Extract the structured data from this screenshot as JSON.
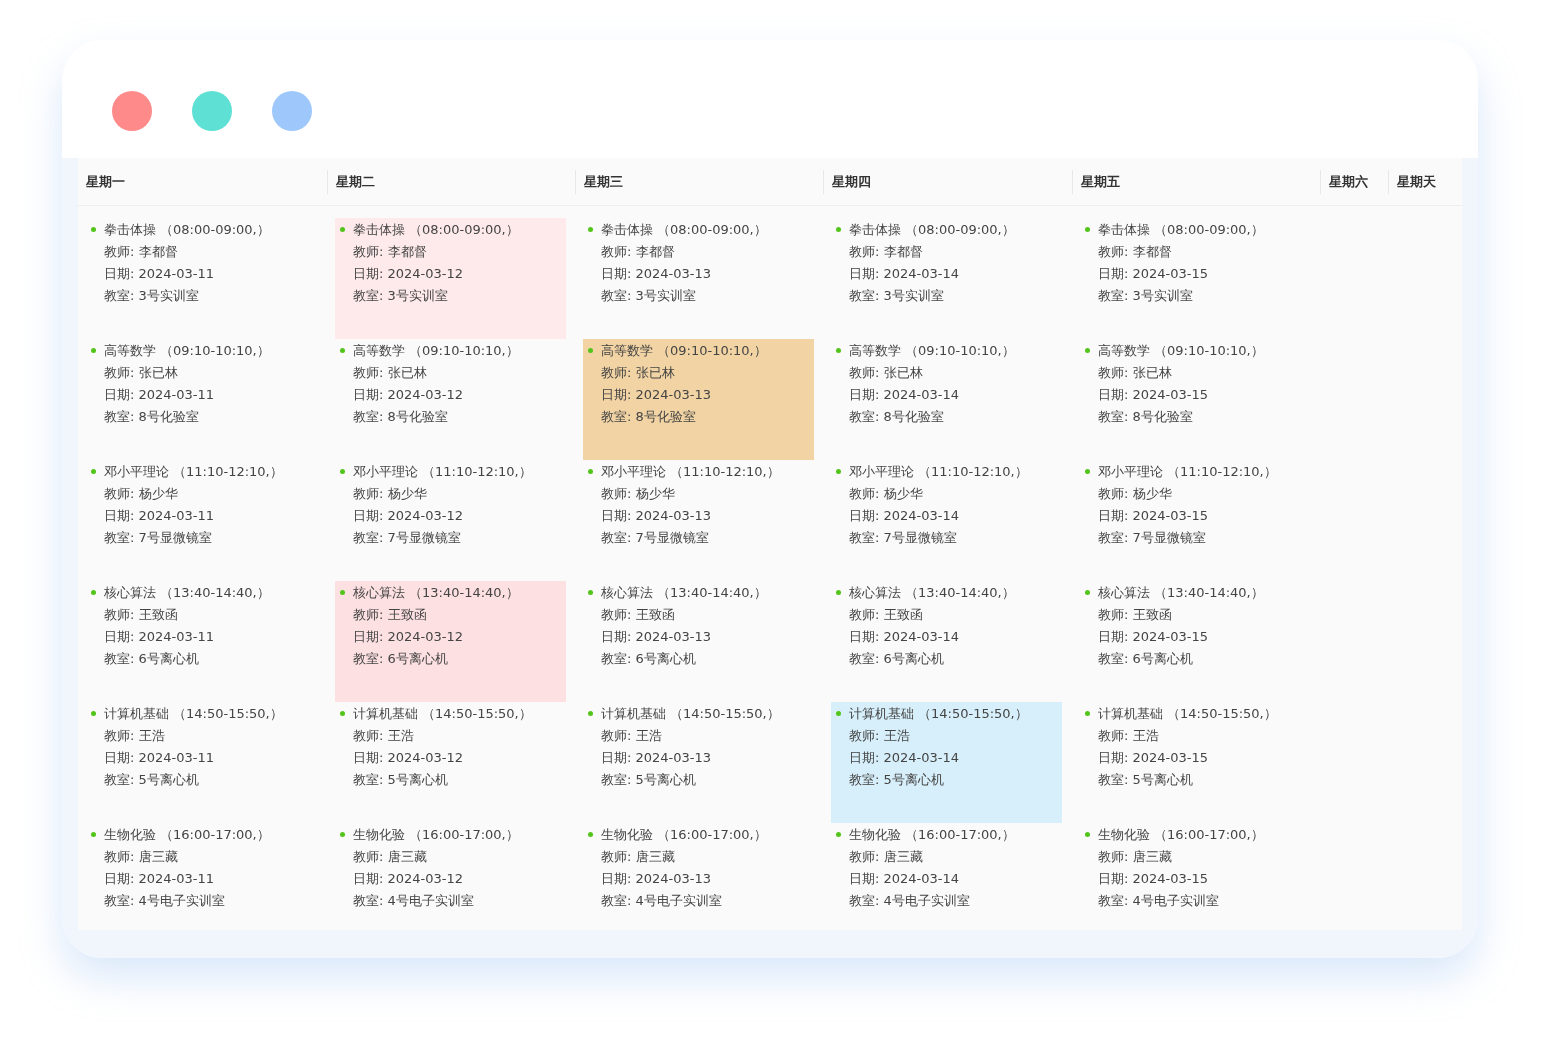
{
  "window_dots": [
    {
      "color": "#ff8a8a"
    },
    {
      "color": "#5fe0d5"
    },
    {
      "color": "#9ec8fb"
    }
  ],
  "days": [
    {
      "label": "星期一",
      "entries": [
        {
          "course": "拳击体操",
          "time": "（08:00-09:00,）",
          "teacher": "教师: 李都督",
          "date": "日期: 2024-03-11",
          "room": "教室: 3号实训室"
        },
        {
          "course": "高等数学",
          "time": "（09:10-10:10,）",
          "teacher": "教师: 张已林",
          "date": "日期: 2024-03-11",
          "room": "教室: 8号化验室"
        },
        {
          "course": "邓小平理论",
          "time": "（11:10-12:10,）",
          "teacher": "教师: 杨少华",
          "date": "日期: 2024-03-11",
          "room": "教室: 7号显微镜室"
        },
        {
          "course": "核心算法",
          "time": "（13:40-14:40,）",
          "teacher": "教师: 王致函",
          "date": "日期: 2024-03-11",
          "room": "教室: 6号离心机"
        },
        {
          "course": "计算机基础",
          "time": "（14:50-15:50,）",
          "teacher": "教师: 王浩",
          "date": "日期: 2024-03-11",
          "room": "教室: 5号离心机"
        },
        {
          "course": "生物化验",
          "time": "（16:00-17:00,）",
          "teacher": "教师: 唐三藏",
          "date": "日期: 2024-03-11",
          "room": "教室: 4号电子实训室"
        }
      ]
    },
    {
      "label": "星期二",
      "entries": [
        {
          "course": "拳击体操",
          "time": "（08:00-09:00,）",
          "teacher": "教师: 李都督",
          "date": "日期: 2024-03-12",
          "room": "教室: 3号实训室",
          "color": "#feeaea"
        },
        {
          "course": "高等数学",
          "time": "（09:10-10:10,）",
          "teacher": "教师: 张已林",
          "date": "日期: 2024-03-12",
          "room": "教室: 8号化验室"
        },
        {
          "course": "邓小平理论",
          "time": "（11:10-12:10,）",
          "teacher": "教师: 杨少华",
          "date": "日期: 2024-03-12",
          "room": "教室: 7号显微镜室"
        },
        {
          "course": "核心算法",
          "time": "（13:40-14:40,）",
          "teacher": "教师: 王致函",
          "date": "日期: 2024-03-12",
          "room": "教室: 6号离心机",
          "color": "#fde0e2"
        },
        {
          "course": "计算机基础",
          "time": "（14:50-15:50,）",
          "teacher": "教师: 王浩",
          "date": "日期: 2024-03-12",
          "room": "教室: 5号离心机"
        },
        {
          "course": "生物化验",
          "time": "（16:00-17:00,）",
          "teacher": "教师: 唐三藏",
          "date": "日期: 2024-03-12",
          "room": "教室: 4号电子实训室"
        }
      ]
    },
    {
      "label": "星期三",
      "entries": [
        {
          "course": "拳击体操",
          "time": "（08:00-09:00,）",
          "teacher": "教师: 李都督",
          "date": "日期: 2024-03-13",
          "room": "教室: 3号实训室"
        },
        {
          "course": "高等数学",
          "time": "（09:10-10:10,）",
          "teacher": "教师: 张已林",
          "date": "日期: 2024-03-13",
          "room": "教室: 8号化验室",
          "color": "#f2d4a4"
        },
        {
          "course": "邓小平理论",
          "time": "（11:10-12:10,）",
          "teacher": "教师: 杨少华",
          "date": "日期: 2024-03-13",
          "room": "教室: 7号显微镜室"
        },
        {
          "course": "核心算法",
          "time": "（13:40-14:40,）",
          "teacher": "教师: 王致函",
          "date": "日期: 2024-03-13",
          "room": "教室: 6号离心机"
        },
        {
          "course": "计算机基础",
          "time": "（14:50-15:50,）",
          "teacher": "教师: 王浩",
          "date": "日期: 2024-03-13",
          "room": "教室: 5号离心机"
        },
        {
          "course": "生物化验",
          "time": "（16:00-17:00,）",
          "teacher": "教师: 唐三藏",
          "date": "日期: 2024-03-13",
          "room": "教室: 4号电子实训室"
        }
      ]
    },
    {
      "label": "星期四",
      "entries": [
        {
          "course": "拳击体操",
          "time": "（08:00-09:00,）",
          "teacher": "教师: 李都督",
          "date": "日期: 2024-03-14",
          "room": "教室: 3号实训室"
        },
        {
          "course": "高等数学",
          "time": "（09:10-10:10,）",
          "teacher": "教师: 张已林",
          "date": "日期: 2024-03-14",
          "room": "教室: 8号化验室"
        },
        {
          "course": "邓小平理论",
          "time": "（11:10-12:10,）",
          "teacher": "教师: 杨少华",
          "date": "日期: 2024-03-14",
          "room": "教室: 7号显微镜室"
        },
        {
          "course": "核心算法",
          "time": "（13:40-14:40,）",
          "teacher": "教师: 王致函",
          "date": "日期: 2024-03-14",
          "room": "教室: 6号离心机"
        },
        {
          "course": "计算机基础",
          "time": "（14:50-15:50,）",
          "teacher": "教师: 王浩",
          "date": "日期: 2024-03-14",
          "room": "教室: 5号离心机",
          "color": "#d7effa"
        },
        {
          "course": "生物化验",
          "time": "（16:00-17:00,）",
          "teacher": "教师: 唐三藏",
          "date": "日期: 2024-03-14",
          "room": "教室: 4号电子实训室"
        }
      ]
    },
    {
      "label": "星期五",
      "entries": [
        {
          "course": "拳击体操",
          "time": "（08:00-09:00,）",
          "teacher": "教师: 李都督",
          "date": "日期: 2024-03-15",
          "room": "教室: 3号实训室"
        },
        {
          "course": "高等数学",
          "time": "（09:10-10:10,）",
          "teacher": "教师: 张已林",
          "date": "日期: 2024-03-15",
          "room": "教室: 8号化验室"
        },
        {
          "course": "邓小平理论",
          "time": "（11:10-12:10,）",
          "teacher": "教师: 杨少华",
          "date": "日期: 2024-03-15",
          "room": "教室: 7号显微镜室"
        },
        {
          "course": "核心算法",
          "time": "（13:40-14:40,）",
          "teacher": "教师: 王致函",
          "date": "日期: 2024-03-15",
          "room": "教室: 6号离心机"
        },
        {
          "course": "计算机基础",
          "time": "（14:50-15:50,）",
          "teacher": "教师: 王浩",
          "date": "日期: 2024-03-15",
          "room": "教室: 5号离心机"
        },
        {
          "course": "生物化验",
          "time": "（16:00-17:00,）",
          "teacher": "教师: 唐三藏",
          "date": "日期: 2024-03-15",
          "room": "教室: 4号电子实训室"
        }
      ]
    },
    {
      "label": "星期六"
    },
    {
      "label": "星期天"
    }
  ]
}
